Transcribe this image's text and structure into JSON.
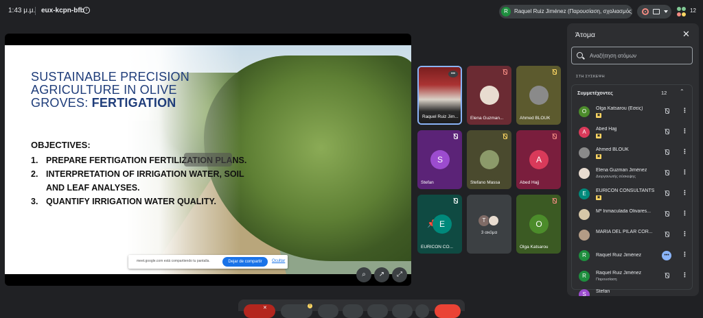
{
  "topbar": {
    "time": "1:43 μ.μ.",
    "meeting_code": "eux-kcpn-bfb",
    "presenter_initial": "R",
    "presenter_label": "Raquel Ruiz Jiménez (Παρουσίαση, σχολιασμός)",
    "participant_count": "12"
  },
  "slide": {
    "title_line1": "SUSTAINABLE PRECISION",
    "title_line2": "AGRICULTURE IN OLIVE",
    "title_line3_prefix": "GROVES: ",
    "title_line3_bold": "FERTIGATION",
    "objectives_heading": "OBJECTIVES:",
    "items": [
      {
        "num": "1.",
        "text": "PREPARE FERTIGATION FERTILIZATION PLANS."
      },
      {
        "num": "2.",
        "text": "INTERPRETATION OF IRRIGATION WATER, SOIL AND LEAF ANALYSES."
      },
      {
        "num": "3.",
        "text": "QUANTIFY IRRIGATION WATER QUALITY."
      }
    ]
  },
  "share_bar": {
    "message": "meet.google.com está compartiendo tu pantalla.",
    "stop_label": "Dejar de compartir",
    "hide_label": "Ocultar"
  },
  "tiles": [
    {
      "name": "Raquel Ruiz Jim...",
      "initial": ""
    },
    {
      "name": "Elena Guzman...",
      "initial": ""
    },
    {
      "name": "Ahmed BLOUK",
      "initial": ""
    },
    {
      "name": "Stefan",
      "initial": "S"
    },
    {
      "name": "Stefano Massa",
      "initial": ""
    },
    {
      "name": "Abed Hajj",
      "initial": "A"
    },
    {
      "name": "EURICON CO...",
      "initial": "E"
    },
    {
      "name": "3 ακόμα",
      "initial": "T"
    },
    {
      "name": "Olga Katsarou",
      "initial": "O"
    }
  ],
  "panel": {
    "title": "Άτομα",
    "search_placeholder": "Αναζήτηση ατόμων",
    "section_label": "ΣΤΗ ΣΥΣΚΕΨΗ",
    "group_label": "Συμμετέχοντες",
    "group_count": "12",
    "people": [
      {
        "name": "Olga Katsarou (Εσείς)",
        "initial": "O",
        "sub": ""
      },
      {
        "name": "Abed Hajj",
        "initial": "A",
        "sub": ""
      },
      {
        "name": "Ahmed BLOUK",
        "initial": "",
        "sub": ""
      },
      {
        "name": "Elena Guzman Jiménez",
        "initial": "",
        "sub": "Διοργανωτής σύσκεψης"
      },
      {
        "name": "EURICON CONSULTANTS",
        "initial": "E",
        "sub": ""
      },
      {
        "name": "Mª Inmaculada Olivares...",
        "initial": "",
        "sub": ""
      },
      {
        "name": "MARÍA DEL PILAR COR...",
        "initial": "",
        "sub": ""
      },
      {
        "name": "Raquel Ruiz Jiménez",
        "initial": "R",
        "sub": ""
      },
      {
        "name": "Raquel Ruiz Jiménez",
        "initial": "R",
        "sub": "Παρουσίαση"
      },
      {
        "name": "Stefan",
        "initial": "S",
        "sub": ""
      }
    ]
  },
  "colors": {
    "background": "#202124",
    "accent_blue": "#1a73e8",
    "slide_title": "#1f3d7a",
    "badge_yellow": "#fdd663"
  }
}
